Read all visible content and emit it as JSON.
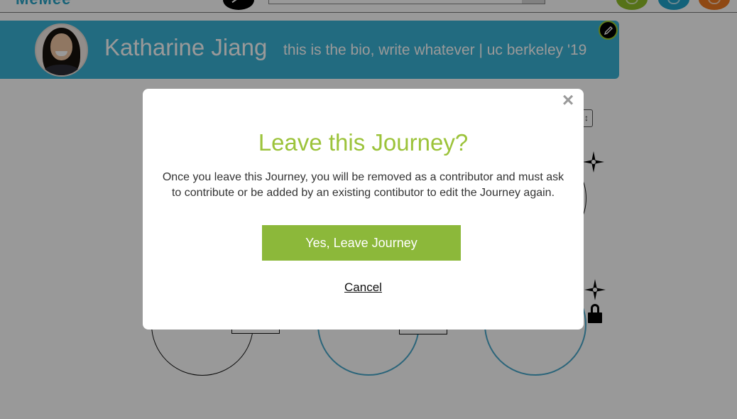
{
  "nav": {
    "logo_text": "MeMee"
  },
  "profile": {
    "name": "Katharine Jiang",
    "bio": "this is the bio, write whatever | uc berkeley '19"
  },
  "canvas": {
    "sort_glyph": "↕"
  },
  "modal": {
    "title": "Leave this Journey?",
    "body": "Once you leave this Journey, you will be removed as a contributor and must ask to contribute or be added by an existing contibutor to edit the Journey again.",
    "confirm_label": "Yes, Leave Journey",
    "cancel_label": "Cancel",
    "close_glyph": "×"
  },
  "colors": {
    "banner": "#3ab3d6",
    "modal_title": "#9cc33a",
    "confirm_button": "#8cb83a",
    "node_active_border": "#49a8cc"
  }
}
